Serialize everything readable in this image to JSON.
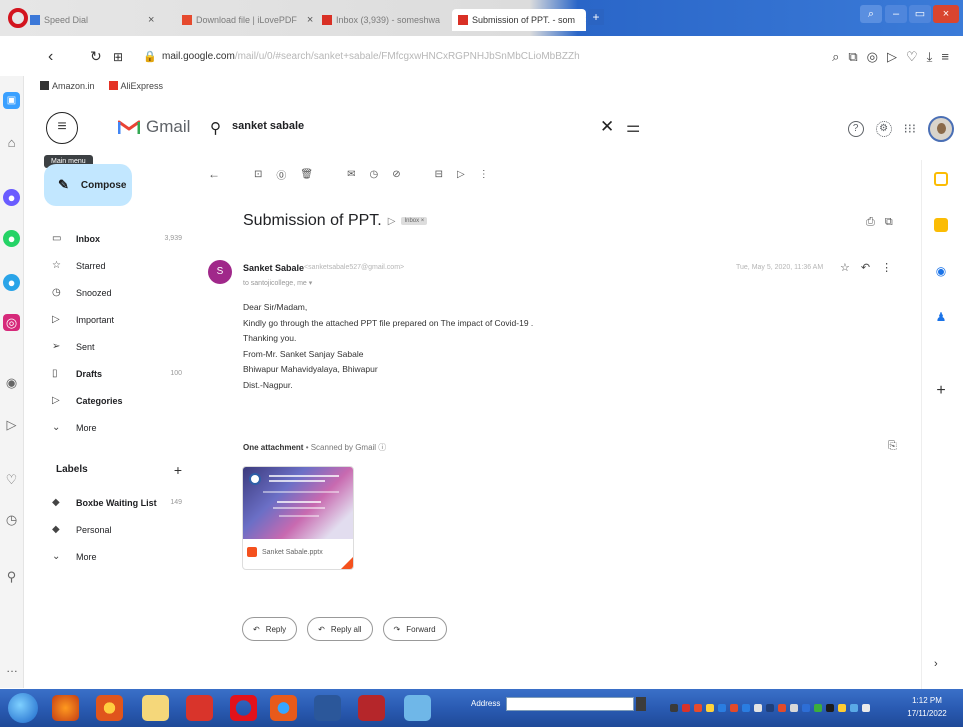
{
  "browser": {
    "tabs": [
      {
        "title": "Speed Dial",
        "icon_color": "#3c78d8"
      },
      {
        "title": "Download file | iLovePDF",
        "icon_color": "#e64a2e"
      },
      {
        "title": "Inbox (3,939) - someshwa",
        "icon_color": "#d93025"
      },
      {
        "title": "Submission of PPT. - som",
        "icon_color": "#d93025",
        "active": true
      }
    ],
    "url_host": "mail.google.com",
    "url_rest": "/mail/u/0/#search/sanket+sabale/FMfcgxwHNCxRGPNHJbSnMbCLioMbBZZh",
    "bookmarks": [
      "Amazon.in",
      "AliExpress"
    ]
  },
  "gmail": {
    "logo_text": "Gmail",
    "menu_tooltip": "Main menu",
    "search_value": "sanket sabale",
    "compose_label": "Compose",
    "nav": [
      {
        "label": "Inbox",
        "icon": "inbox-icon",
        "glyph": "▭",
        "count": "3,939",
        "bold": true
      },
      {
        "label": "Starred",
        "icon": "star-icon",
        "glyph": "☆",
        "count": "",
        "bold": false
      },
      {
        "label": "Snoozed",
        "icon": "clock-icon",
        "glyph": "◷",
        "count": "",
        "bold": false
      },
      {
        "label": "Important",
        "icon": "important-icon",
        "glyph": "▷",
        "count": "",
        "bold": false
      },
      {
        "label": "Sent",
        "icon": "sent-icon",
        "glyph": "➢",
        "count": "",
        "bold": false
      },
      {
        "label": "Drafts",
        "icon": "draft-icon",
        "glyph": "▯",
        "count": "100",
        "bold": true
      },
      {
        "label": "Categories",
        "icon": "label-icon",
        "glyph": "▷",
        "count": "",
        "bold": true
      },
      {
        "label": "More",
        "icon": "chevron-down-icon",
        "glyph": "⌄",
        "count": "",
        "bold": false
      }
    ],
    "labels_title": "Labels",
    "labels": [
      {
        "label": "Boxbe Waiting List",
        "count": "149",
        "bold": true
      },
      {
        "label": "Personal",
        "count": "",
        "bold": false
      },
      {
        "label": "More",
        "count": "",
        "bold": false,
        "chevron": true
      }
    ]
  },
  "message": {
    "subject": "Submission of PPT.",
    "inbox_chip": "Inbox ×",
    "sender_initial": "S",
    "sender_name": "Sanket Sabale",
    "sender_email": "<sanketsabale527@gmail.com>",
    "to_line": "to santojicollege, me ▾",
    "date": "Tue, May 5, 2020, 11:36 AM",
    "body_lines": [
      "Dear Sir/Madam,",
      "Kindly go through the attached PPT file prepared on The impact of  Covid-19 .",
      "Thanking you.",
      "From-Mr. Sanket Sanjay Sabale",
      "Bhiwapur Mahavidyalaya, Bhiwapur",
      "Dist.-Nagpur."
    ],
    "attachment_head_bold": "One attachment",
    "attachment_head_rest": " • Scanned by Gmail ⓘ",
    "attachment_file": "Sanket Sabale.pptx",
    "reply_label": "Reply",
    "reply_all_label": "Reply all",
    "forward_label": "Forward"
  },
  "taskbar": {
    "address_label": "Address",
    "clock_time": "1:12 PM",
    "clock_date": "17/11/2022"
  },
  "colors": {
    "gmail_red": "#ea4335",
    "compose_bg": "#c2e7ff",
    "sender_avatar": "#a0288a",
    "taskbar_blue": "#2a5bb3"
  }
}
